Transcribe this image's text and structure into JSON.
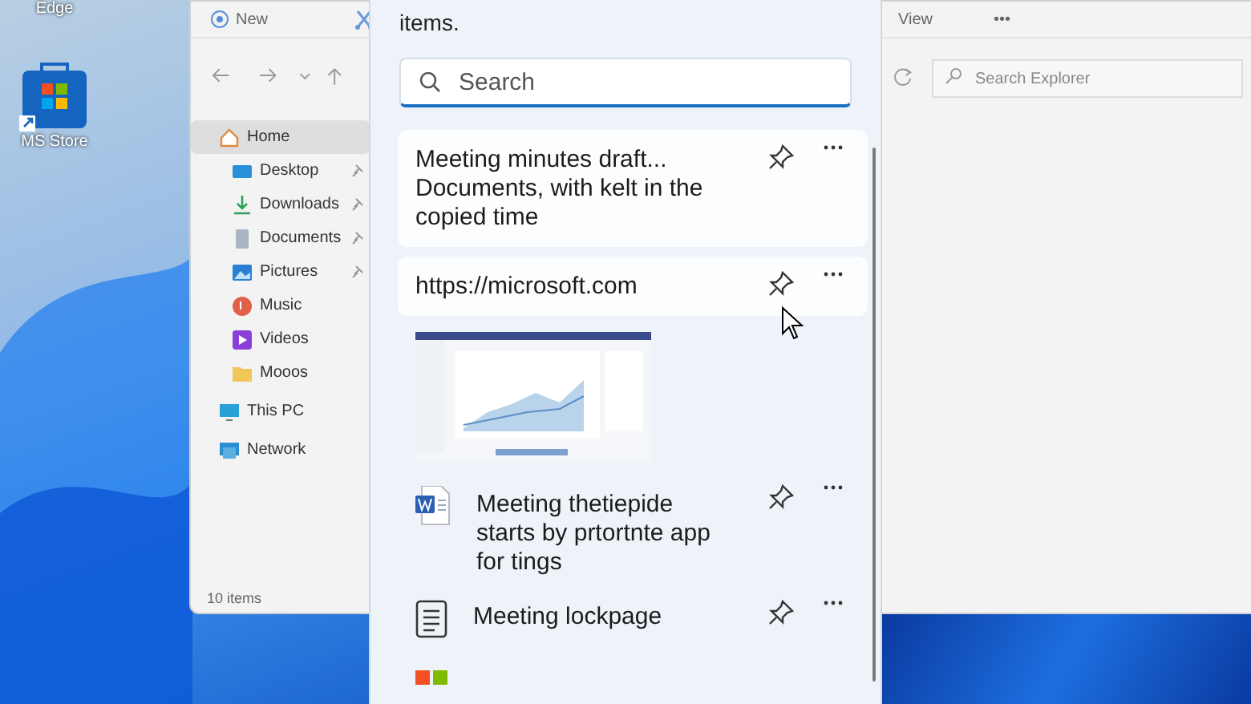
{
  "desktop_icons": [
    {
      "label": "Edge",
      "kind": "edge"
    },
    {
      "label": "MS Store",
      "kind": "store"
    }
  ],
  "explorer": {
    "toolbar": {
      "new": "New",
      "view": "View",
      "more": "•••"
    },
    "search": {
      "placeholder": "Search Explorer"
    },
    "sidebar": [
      {
        "label": "Home",
        "kind": "home",
        "selected": true,
        "pinned": false,
        "children": [
          {
            "label": "Desktop",
            "kind": "desktop",
            "selected": false,
            "pinned": true
          },
          {
            "label": "Downloads",
            "kind": "download",
            "selected": false,
            "pinned": true
          },
          {
            "label": "Documents",
            "kind": "documents",
            "selected": false,
            "pinned": true
          },
          {
            "label": "Pictures",
            "kind": "pictures",
            "selected": false,
            "pinned": true
          },
          {
            "label": "Music",
            "kind": "music",
            "selected": false,
            "pinned": false
          },
          {
            "label": "Videos",
            "kind": "videos",
            "selected": false,
            "pinned": false
          },
          {
            "label": "Mooos",
            "kind": "folder",
            "selected": false,
            "pinned": false
          }
        ]
      },
      {
        "label": "This PC",
        "kind": "pc",
        "selected": false,
        "pinned": false
      },
      {
        "label": "Network",
        "kind": "network",
        "selected": false,
        "pinned": false
      }
    ],
    "status": "10 items"
  },
  "clipboard": {
    "notice": "items.",
    "search": {
      "placeholder": "Search"
    },
    "items": [
      {
        "kind": "text",
        "text": "Meeting minutes draft... Documents, with kelt in the copied time",
        "highlighted": true
      },
      {
        "kind": "text",
        "text": "https://microsoft.com",
        "highlighted": true
      },
      {
        "kind": "image",
        "highlighted": false
      },
      {
        "kind": "word",
        "text": "Meeting thetiepide starts by prtortnte app for tings",
        "highlighted": false
      },
      {
        "kind": "doc",
        "text": "Meeting lockpage",
        "highlighted": false
      },
      {
        "kind": "store",
        "highlighted": false
      }
    ]
  }
}
